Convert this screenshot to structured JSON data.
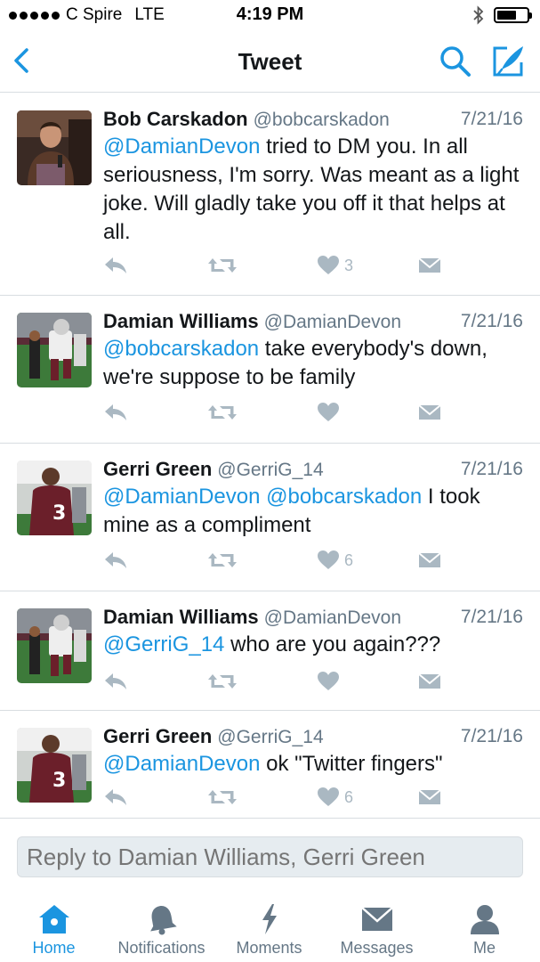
{
  "status_bar": {
    "carrier": "C Spire",
    "network": "LTE",
    "time": "4:19 PM",
    "battery_level": 0.65
  },
  "nav": {
    "title": "Tweet"
  },
  "colors": {
    "accent": "#1b95e0",
    "action_gray": "#aab8c2",
    "secondary_text": "#657786",
    "avatar_bob": "#5a3a2a",
    "avatar_field": "#3d7a3a"
  },
  "tweets": [
    {
      "name": "Bob Carskadon",
      "handle": "@bobcarskadon",
      "date": "7/21/16",
      "mention": "@DamianDevon",
      "text": " tried to DM you. In all seriousness, I'm sorry. Was meant as a light joke. Will gladly take you off it that helps at all.",
      "likes": "3"
    },
    {
      "name": "Damian Williams",
      "handle": "@DamianDevon",
      "date": "7/21/16",
      "mention": "@bobcarskadon",
      "text": " take everybody's down, we're suppose to be family",
      "likes": ""
    },
    {
      "name": "Gerri Green",
      "handle": "@GerriG_14",
      "date": "7/21/16",
      "mention": "@DamianDevon @bobcarskadon",
      "text": " I took mine as a compliment",
      "likes": "6"
    },
    {
      "name": "Damian Williams",
      "handle": "@DamianDevon",
      "date": "7/21/16",
      "mention": "@GerriG_14",
      "text": " who are you again???",
      "likes": ""
    },
    {
      "name": "Gerri Green",
      "handle": "@GerriG_14",
      "date": "7/21/16",
      "mention": "@DamianDevon",
      "text": " ok \"Twitter fingers\"",
      "likes": "6"
    }
  ],
  "reply": {
    "placeholder": "Reply to Damian Williams, Gerri Green"
  },
  "tabs": [
    {
      "label": "Home",
      "icon": "home-icon",
      "active": true
    },
    {
      "label": "Notifications",
      "icon": "bell-icon",
      "active": false
    },
    {
      "label": "Moments",
      "icon": "lightning-icon",
      "active": false
    },
    {
      "label": "Messages",
      "icon": "envelope-icon",
      "active": false
    },
    {
      "label": "Me",
      "icon": "person-icon",
      "active": false
    }
  ]
}
